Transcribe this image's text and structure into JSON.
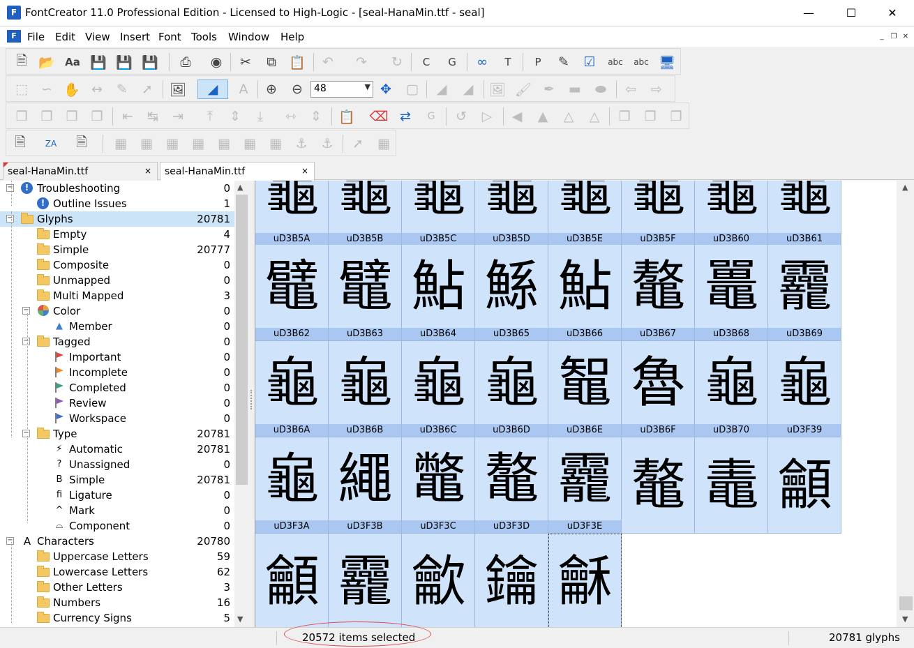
{
  "window": {
    "title": "FontCreator 11.0 Professional Edition - Licensed to High-Logic - [seal-HanaMin.ttf - seal]",
    "app_icon": "F",
    "controls": [
      "minimize",
      "maximize",
      "close"
    ]
  },
  "menu": {
    "items": [
      "File",
      "Edit",
      "View",
      "Insert",
      "Font",
      "Tools",
      "Window",
      "Help"
    ]
  },
  "toolbar": {
    "zoom_value": "48"
  },
  "tabs": [
    {
      "label": "seal-HanaMin.ttf",
      "close": "×"
    },
    {
      "label": "seal-HanaMin.ttf",
      "close": "×"
    }
  ],
  "tree": [
    {
      "label": "Troubleshooting",
      "count": "0",
      "icon": "exclamation-icon"
    },
    {
      "label": "Outline Issues",
      "count": "1",
      "icon": "exclamation-icon"
    },
    {
      "label": "Glyphs",
      "count": "20781",
      "icon": "folder-icon",
      "selected": true
    },
    {
      "label": "Empty",
      "count": "4",
      "icon": "folder-icon"
    },
    {
      "label": "Simple",
      "count": "20777",
      "icon": "folder-icon"
    },
    {
      "label": "Composite",
      "count": "0",
      "icon": "folder-icon"
    },
    {
      "label": "Unmapped",
      "count": "0",
      "icon": "folder-icon"
    },
    {
      "label": "Multi Mapped",
      "count": "3",
      "icon": "folder-icon"
    },
    {
      "label": "Color",
      "count": "0",
      "icon": "color-wheel-icon"
    },
    {
      "label": "Member",
      "count": "0",
      "icon": "triangle-icon"
    },
    {
      "label": "Tagged",
      "count": "0",
      "icon": "folder-icon"
    },
    {
      "label": "Important",
      "count": "0",
      "icon": "red-flag-icon"
    },
    {
      "label": "Incomplete",
      "count": "0",
      "icon": "orange-flag-icon"
    },
    {
      "label": "Completed",
      "count": "0",
      "icon": "green-flag-icon"
    },
    {
      "label": "Review",
      "count": "0",
      "icon": "purple-flag-icon"
    },
    {
      "label": "Workspace",
      "count": "0",
      "icon": "blue-flag-icon"
    },
    {
      "label": "Type",
      "count": "20781",
      "icon": "folder-icon"
    },
    {
      "label": "Automatic",
      "count": "20781",
      "icon": "lightning-icon"
    },
    {
      "label": "Unassigned",
      "count": "0",
      "icon": "question-icon"
    },
    {
      "label": "Simple",
      "count": "20781",
      "icon": "b-icon"
    },
    {
      "label": "Ligature",
      "count": "0",
      "icon": "fi-icon"
    },
    {
      "label": "Mark",
      "count": "0",
      "icon": "caret-icon"
    },
    {
      "label": "Component",
      "count": "0",
      "icon": "component-icon"
    },
    {
      "label": "Characters",
      "count": "20780",
      "icon": "a-icon"
    },
    {
      "label": "Uppercase Letters",
      "count": "59",
      "icon": "folder-icon"
    },
    {
      "label": "Lowercase Letters",
      "count": "62",
      "icon": "folder-icon"
    },
    {
      "label": "Other Letters",
      "count": "3",
      "icon": "folder-icon"
    },
    {
      "label": "Numbers",
      "count": "16",
      "icon": "folder-icon"
    },
    {
      "label": "Currency Signs",
      "count": "5",
      "icon": "folder-icon"
    }
  ],
  "tree_icon_glyphs": {
    "exclamation-icon": "!",
    "triangle-icon": "▲",
    "lightning-icon": "⚡",
    "question-icon": "?",
    "b-icon": "B",
    "fi-icon": "fi",
    "caret-icon": "^",
    "component-icon": "⌓",
    "a-icon": "A"
  },
  "flag_colors": {
    "red-flag-icon": "#e0463c",
    "orange-flag-icon": "#f08a24",
    "green-flag-icon": "#3aa37a",
    "purple-flag-icon": "#8e57b8",
    "blue-flag-icon": "#3f6fd1"
  },
  "glyph_rows": [
    [
      {
        "char": "龜",
        "name": "uD3B5A"
      },
      {
        "char": "龜",
        "name": "uD3B5B"
      },
      {
        "char": "龜",
        "name": "uD3B5C"
      },
      {
        "char": "龜",
        "name": "uD3B5D"
      },
      {
        "char": "龜",
        "name": "uD3B5E"
      },
      {
        "char": "龜",
        "name": "uD3B5F"
      },
      {
        "char": "龜",
        "name": "uD3B60"
      },
      {
        "char": "龜",
        "name": "uD3B61"
      }
    ],
    [
      {
        "char": "鼊",
        "name": "uD3B62"
      },
      {
        "char": "鼊",
        "name": "uD3B63"
      },
      {
        "char": "鮎",
        "name": "uD3B64"
      },
      {
        "char": "鯀",
        "name": "uD3B65"
      },
      {
        "char": "鮎",
        "name": "uD3B66"
      },
      {
        "char": "鼇",
        "name": "uD3B67"
      },
      {
        "char": "鼉",
        "name": "uD3B68"
      },
      {
        "char": "龗",
        "name": "uD3B69"
      }
    ],
    [
      {
        "char": "龜",
        "name": "uD3B6A"
      },
      {
        "char": "龜",
        "name": "uD3B6B"
      },
      {
        "char": "龜",
        "name": "uD3B6C"
      },
      {
        "char": "龜",
        "name": "uD3B6D"
      },
      {
        "char": "鼅",
        "name": "uD3B6E"
      },
      {
        "char": "魯",
        "name": "uD3B6F"
      },
      {
        "char": "龜",
        "name": "uD3B70"
      },
      {
        "char": "龜",
        "name": "uD3F39"
      }
    ],
    [
      {
        "char": "龜",
        "name": "uD3F3A"
      },
      {
        "char": "繩",
        "name": "uD3F3B"
      },
      {
        "char": "鼈",
        "name": "uD3F3C"
      },
      {
        "char": "鼇",
        "name": "uD3F3D"
      },
      {
        "char": "龗",
        "name": "uD3F3E"
      },
      {
        "char": "鼇",
        "name": ""
      },
      {
        "char": "鼃",
        "name": ""
      },
      {
        "char": "龥",
        "name": ""
      }
    ],
    [
      {
        "char": "龥",
        "name": ""
      },
      {
        "char": "龗",
        "name": ""
      },
      {
        "char": "龡",
        "name": ""
      },
      {
        "char": "鑰",
        "name": ""
      },
      {
        "char": "龢",
        "name": ""
      }
    ]
  ],
  "status": {
    "selection": "20572 items selected",
    "glyph_count": "20781 glyphs"
  }
}
